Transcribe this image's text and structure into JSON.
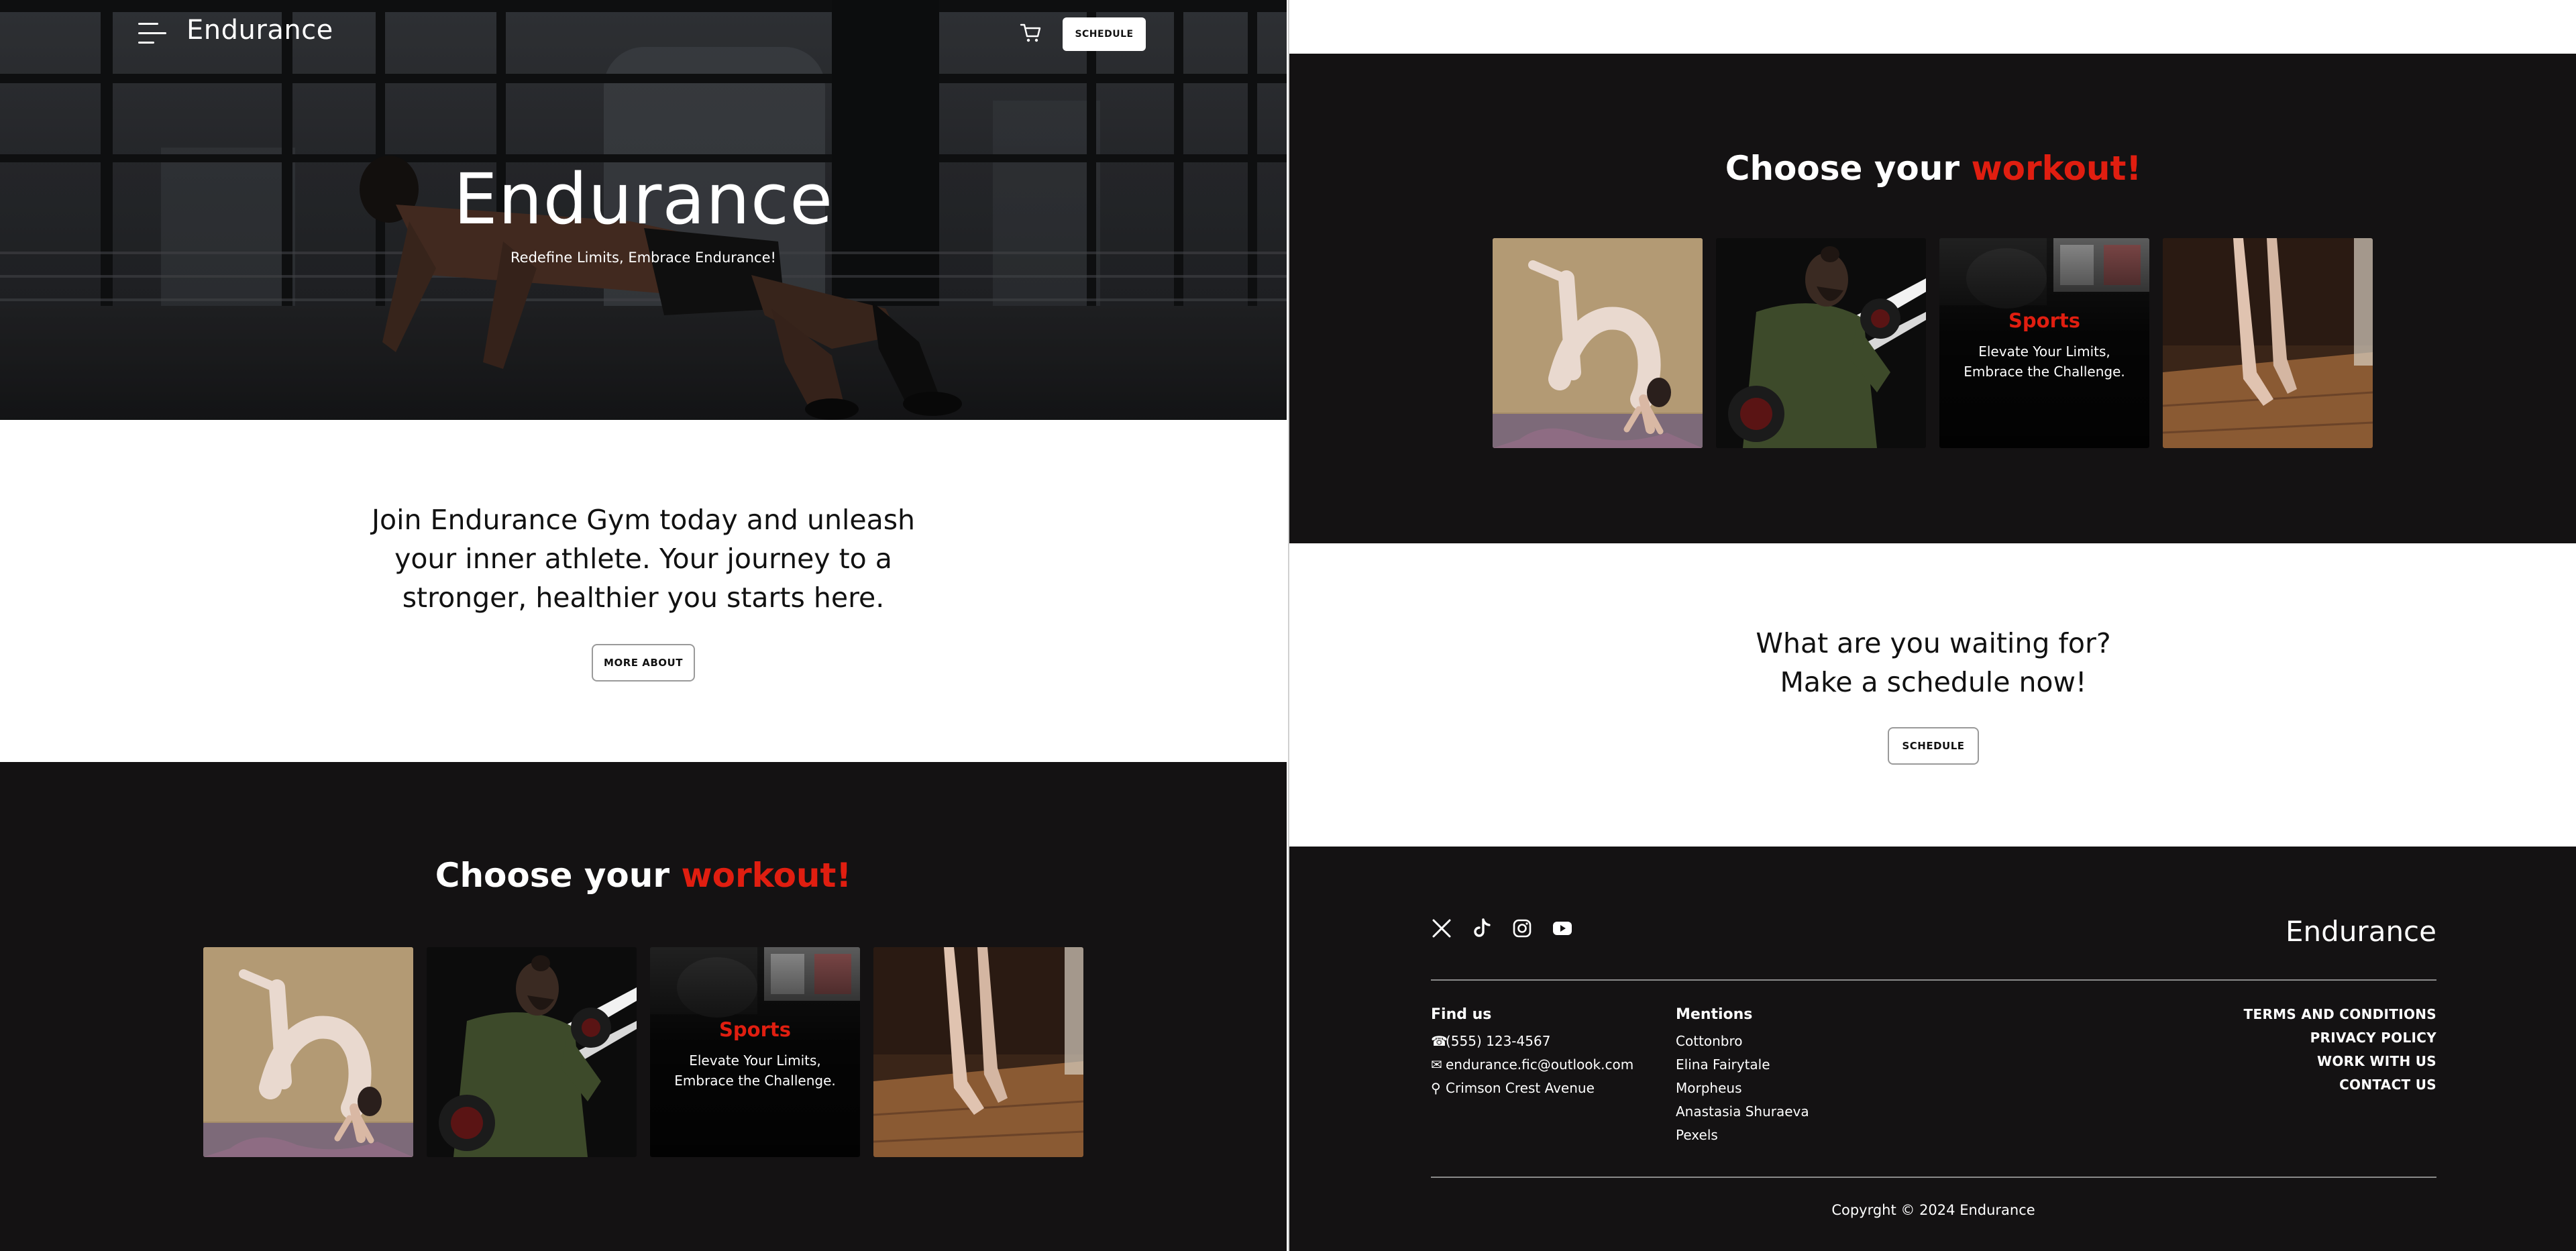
{
  "header": {
    "brand": "Endurance",
    "schedule_label": "SCHEDULE",
    "menu_icon": "hamburger-menu-icon",
    "cart_icon": "shopping-cart-icon"
  },
  "hero": {
    "title": "Endurance",
    "subtitle": "Redefine Limits, Embrace Endurance!"
  },
  "intro": {
    "line1": "Join Endurance Gym today and unleash",
    "line2": "your inner athlete. Your journey to a",
    "line3": "stronger, healthier you starts here.",
    "button": "MORE ABOUT"
  },
  "workout": {
    "title_prefix": "Choose your ",
    "title_accent": "workout!",
    "cards": [
      {
        "image": "yoga-backbend-photo"
      },
      {
        "image": "dumbbell-athlete-photo"
      },
      {
        "image": "sports-photo",
        "title": "Sports",
        "line1": "Elevate Your Limits,",
        "line2": "Embrace the Challenge."
      },
      {
        "image": "ballet-pointe-photo"
      }
    ]
  },
  "cta": {
    "line1": "What are you waiting for?",
    "line2": "Make a schedule now!",
    "button": "SCHEDULE"
  },
  "footer": {
    "brand": "Endurance",
    "socials": [
      "x-icon",
      "tiktok-icon",
      "instagram-icon",
      "youtube-icon"
    ],
    "find_us": {
      "title": "Find us",
      "phone": "(555) 123-4567",
      "email": "endurance.fic@outlook.com",
      "address": "Crimson Crest Avenue"
    },
    "mentions": {
      "title": "Mentions",
      "names": [
        "Cottonbro",
        "Elina Fairytale",
        "Morpheus",
        "Anastasia Shuraeva",
        "Pexels"
      ]
    },
    "links": [
      "TERMS AND CONDITIONS",
      "PRIVACY POLICY",
      "WORK WITH US",
      "CONTACT US"
    ],
    "copyright": "Copyrght © 2024 Endurance"
  },
  "colors": {
    "accent": "#e01e10",
    "dark_bg": "#141213",
    "white": "#ffffff"
  }
}
